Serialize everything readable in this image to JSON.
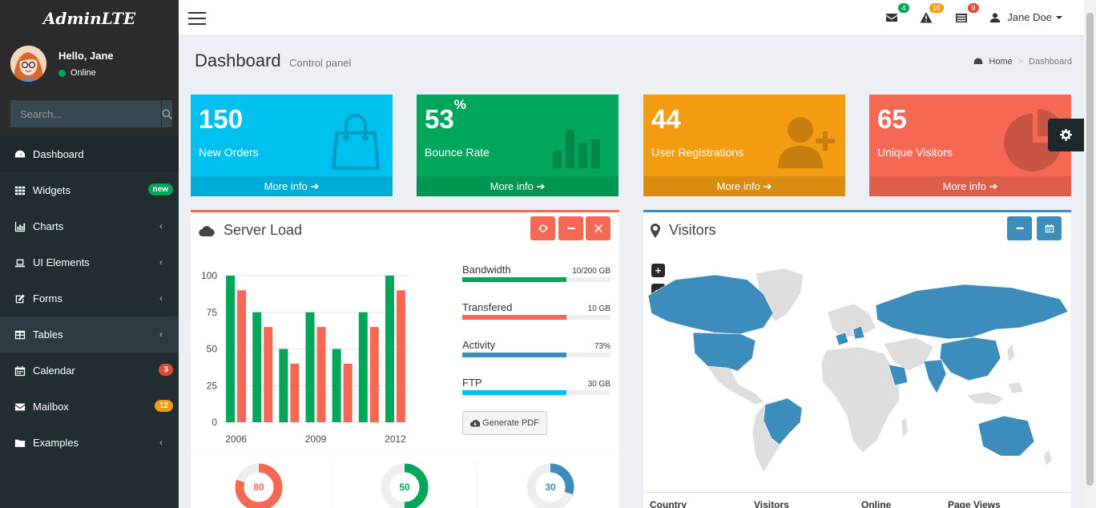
{
  "brand": "AdminLTE",
  "user_panel": {
    "greeting": "Hello, Jane",
    "status": "Online"
  },
  "search": {
    "placeholder": "Search..."
  },
  "menu": [
    {
      "label": "Dashboard",
      "icon": "dashboard-icon",
      "active": true
    },
    {
      "label": "Widgets",
      "icon": "th-icon",
      "badge": "new",
      "badge_color": "#00a65a"
    },
    {
      "label": "Charts",
      "icon": "bar-chart-icon",
      "chevron": true
    },
    {
      "label": "UI Elements",
      "icon": "laptop-icon",
      "chevron": true
    },
    {
      "label": "Forms",
      "icon": "edit-icon",
      "chevron": true
    },
    {
      "label": "Tables",
      "icon": "table-icon",
      "chevron": true
    },
    {
      "label": "Calendar",
      "icon": "calendar-icon",
      "badge": "3",
      "badge_color": "#dd4b39"
    },
    {
      "label": "Mailbox",
      "icon": "envelope-icon",
      "badge": "12",
      "badge_color": "#f39c12"
    },
    {
      "label": "Examples",
      "icon": "folder-icon",
      "chevron": true
    }
  ],
  "header": {
    "messages_count": "4",
    "alerts_count": "10",
    "tasks_count": "9",
    "user_name": "Jane Doe"
  },
  "page": {
    "title": "Dashboard",
    "subtitle": "Control panel",
    "breadcrumb_home": "Home",
    "breadcrumb_current": "Dashboard"
  },
  "stat_boxes": [
    {
      "value": "150",
      "suffix": "",
      "label": "New Orders",
      "link": "More info",
      "color": "#00c0ef",
      "icon": "shopping-bag-icon"
    },
    {
      "value": "53",
      "suffix": "%",
      "label": "Bounce Rate",
      "link": "More info",
      "color": "#00a65a",
      "icon": "bar-chart-icon"
    },
    {
      "value": "44",
      "suffix": "",
      "label": "User Registrations",
      "link": "More info",
      "color": "#f39c12",
      "icon": "user-add-icon"
    },
    {
      "value": "65",
      "suffix": "",
      "label": "Unique Visitors",
      "link": "More info",
      "color": "#f56954",
      "icon": "pie-chart-icon"
    }
  ],
  "server_load": {
    "title": "Server Load",
    "progress": [
      {
        "name": "Bandwidth",
        "value": "10/200 GB",
        "fraction": 0.7,
        "color": "#00a65a"
      },
      {
        "name": "Transfered",
        "value": "10 GB",
        "fraction": 0.7,
        "color": "#f56954"
      },
      {
        "name": "Activity",
        "value": "73%",
        "fraction": 0.7,
        "color": "#3c8dbc"
      },
      {
        "name": "FTP",
        "value": "30 GB",
        "fraction": 0.7,
        "color": "#00c0ef"
      }
    ],
    "pdf_button": "Generate PDF",
    "knobs": [
      {
        "value": "80",
        "fraction": 0.8,
        "color": "#f56954"
      },
      {
        "value": "50",
        "fraction": 0.5,
        "color": "#00a65a"
      },
      {
        "value": "30",
        "fraction": 0.3,
        "color": "#3c8dbc"
      }
    ]
  },
  "chart_data": {
    "type": "bar",
    "x": [
      2006,
      2007,
      2008,
      2009,
      2010,
      2011,
      2012
    ],
    "x_tick_labels": [
      "2006",
      "2009",
      "2012"
    ],
    "series": [
      {
        "values": [
          100,
          75,
          50,
          75,
          50,
          75,
          100
        ],
        "color": "#00a65a"
      },
      {
        "values": [
          90,
          65,
          40,
          65,
          40,
          65,
          90
        ],
        "color": "#f56954"
      }
    ],
    "yticks": [
      0,
      25,
      50,
      75,
      100
    ],
    "ylim": [
      0,
      100
    ],
    "grid": true
  },
  "visitors": {
    "title": "Visitors",
    "zoom_in": "+",
    "zoom_out": "−",
    "table_headers": [
      "Country",
      "Visitors",
      "Online",
      "Page Views"
    ]
  }
}
